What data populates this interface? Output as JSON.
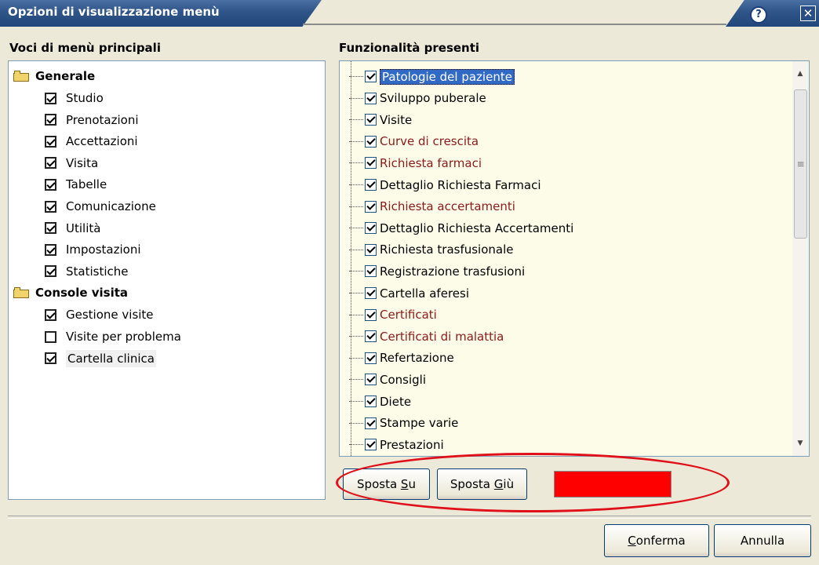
{
  "window": {
    "title": "Opzioni di visualizzazione menù"
  },
  "left": {
    "heading": "Voci di menù principali",
    "groups": [
      {
        "label": "Generale",
        "items": [
          {
            "label": "Studio",
            "checked": true
          },
          {
            "label": "Prenotazioni",
            "checked": true
          },
          {
            "label": "Accettazioni",
            "checked": true
          },
          {
            "label": "Visita",
            "checked": true
          },
          {
            "label": "Tabelle",
            "checked": true
          },
          {
            "label": "Comunicazione",
            "checked": true
          },
          {
            "label": "Utilità",
            "checked": true
          },
          {
            "label": "Impostazioni",
            "checked": true
          },
          {
            "label": "Statistiche",
            "checked": true
          }
        ]
      },
      {
        "label": "Console visita",
        "items": [
          {
            "label": "Gestione visite",
            "checked": true
          },
          {
            "label": "Visite per problema",
            "checked": false
          },
          {
            "label": "Cartella clinica",
            "checked": true
          }
        ]
      }
    ]
  },
  "right": {
    "heading": "Funzionalità presenti",
    "items": [
      {
        "label": "Patologie del paziente",
        "checked": true,
        "color": "selected"
      },
      {
        "label": "Sviluppo puberale",
        "checked": true,
        "color": "black"
      },
      {
        "label": "Visite",
        "checked": true,
        "color": "black"
      },
      {
        "label": "Curve di crescita",
        "checked": true,
        "color": "red"
      },
      {
        "label": "Richiesta farmaci",
        "checked": true,
        "color": "red"
      },
      {
        "label": "Dettaglio Richiesta Farmaci",
        "checked": true,
        "color": "black"
      },
      {
        "label": "Richiesta accertamenti",
        "checked": true,
        "color": "red"
      },
      {
        "label": "Dettaglio Richiesta Accertamenti",
        "checked": true,
        "color": "black"
      },
      {
        "label": "Richiesta trasfusionale",
        "checked": true,
        "color": "black"
      },
      {
        "label": "Registrazione trasfusioni",
        "checked": true,
        "color": "black"
      },
      {
        "label": "Cartella aferesi",
        "checked": true,
        "color": "black"
      },
      {
        "label": "Certificati",
        "checked": true,
        "color": "red"
      },
      {
        "label": "Certificati di malattia",
        "checked": true,
        "color": "red"
      },
      {
        "label": "Refertazione",
        "checked": true,
        "color": "black"
      },
      {
        "label": "Consigli",
        "checked": true,
        "color": "black"
      },
      {
        "label": "Diete",
        "checked": true,
        "color": "black"
      },
      {
        "label": "Stampe varie",
        "checked": true,
        "color": "black"
      },
      {
        "label": "Prestazioni",
        "checked": true,
        "color": "black"
      }
    ]
  },
  "buttons": {
    "move_up": {
      "pre": "Sposta ",
      "accel": "S",
      "post": "u"
    },
    "move_down": {
      "pre": "Sposta ",
      "accel": "G",
      "post": "iù"
    },
    "confirm": {
      "pre": "",
      "accel": "C",
      "post": "onferma"
    },
    "cancel": {
      "label": "Annulla"
    }
  },
  "colors": {
    "swatch": "#ff0000",
    "highlight_annotation": "#e0101a",
    "red_item": "#8b1a1a",
    "selection": "#316ac5"
  },
  "icons": {
    "help": "help-icon",
    "close": "close-icon",
    "folder": "folder-icon"
  }
}
